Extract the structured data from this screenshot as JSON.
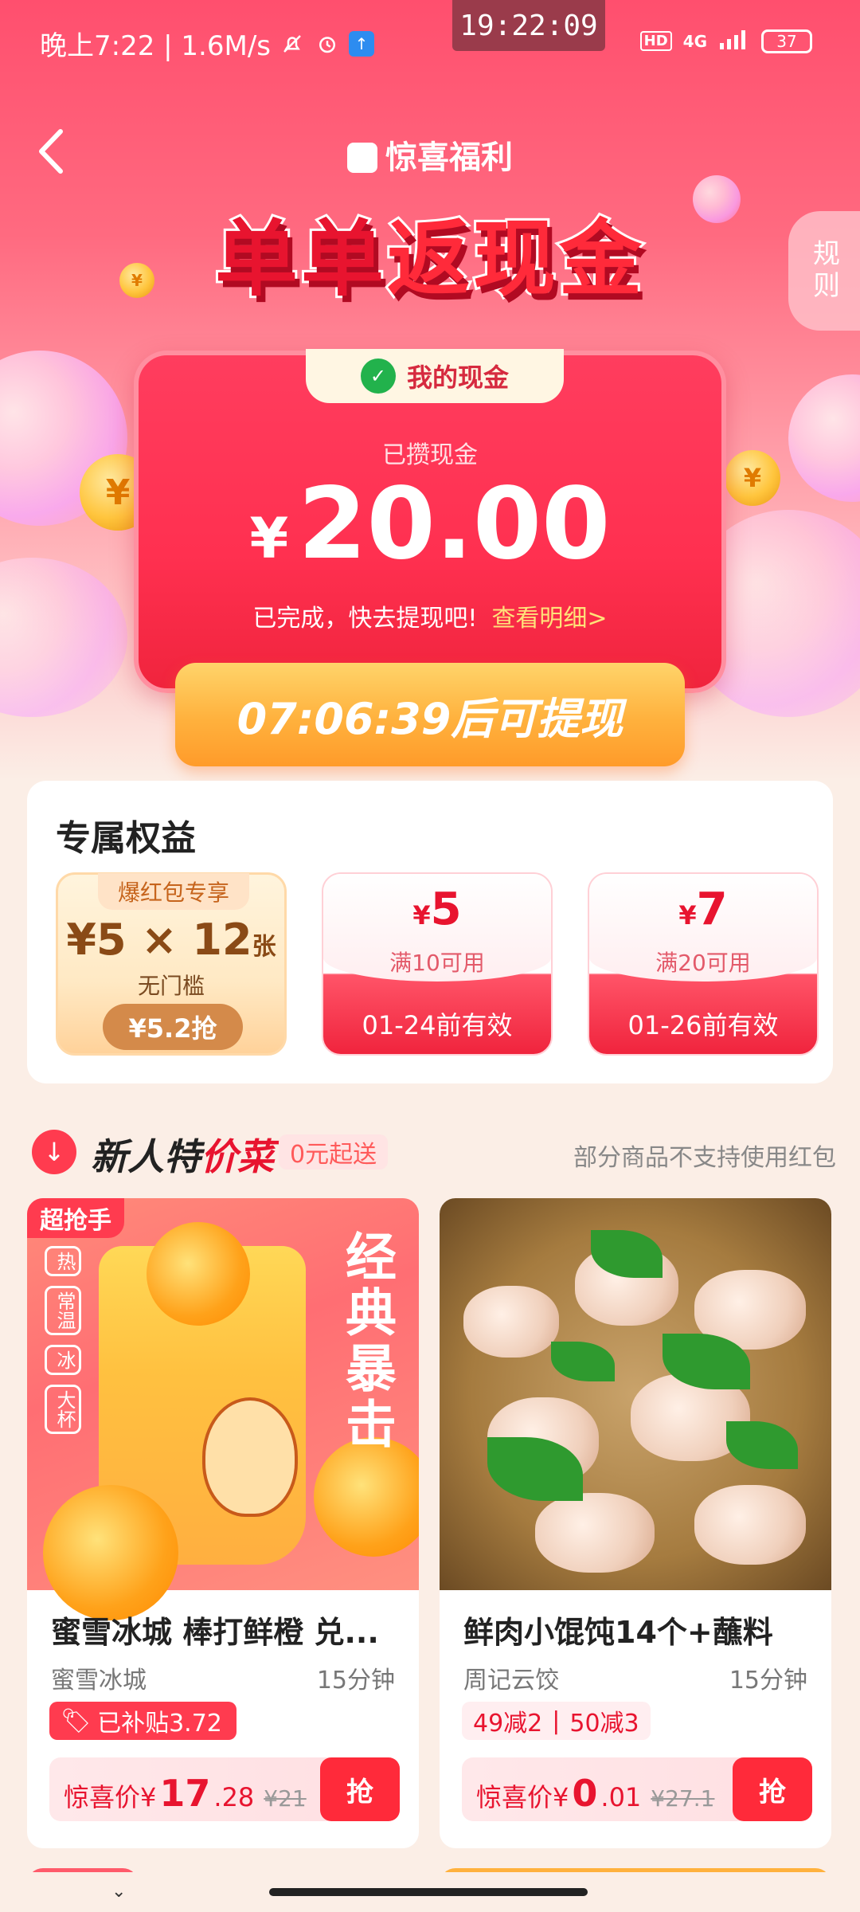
{
  "status_bar": {
    "left_text": "晚上7:22 | 1.6M/s",
    "center_time": "19:22:09",
    "hd": "HD",
    "network": "4G",
    "battery": "37"
  },
  "header": {
    "brand": "惊喜福利",
    "title_a": "单单",
    "title_b": "返现金",
    "rules": "规则"
  },
  "cash_card": {
    "tab_label": "我的现金",
    "saved_label": "已攒现金",
    "currency": "¥",
    "amount": "20.00",
    "done_text": "已完成，快去提现吧!",
    "detail_link": "查看明细>",
    "withdraw": "07:06:39后可提现"
  },
  "benefits": {
    "title": "专属权益",
    "bonus": {
      "tag": "爆红包专享",
      "value": "¥5 × 12",
      "unit": "张",
      "sub": "无门槛",
      "button": "¥5.2抢"
    },
    "coupons": [
      {
        "currency": "¥",
        "value": "5",
        "condition": "满10可用",
        "expiry": "01-24前有效"
      },
      {
        "currency": "¥",
        "value": "7",
        "condition": "满20可用",
        "expiry": "01-26前有效"
      }
    ]
  },
  "section": {
    "title_a": "新人特",
    "title_b": "价菜",
    "pill": "0元起送",
    "note": "部分商品不支持使用红包"
  },
  "products": [
    {
      "badge": "超抢手",
      "options": [
        "热",
        "常温",
        "冰",
        "大杯"
      ],
      "image_text": "经典暴击",
      "name": "蜜雪冰城 棒打鲜橙 兑...",
      "shop": "蜜雪冰城",
      "time": "15分钟",
      "subsidy": "已补贴3.72",
      "price_label": "惊喜价¥",
      "price_int": "17",
      "price_dec": ".28",
      "old_price": "¥21",
      "grab": "抢"
    },
    {
      "name": "鲜肉小馄饨14个+蘸料",
      "shop": "周记云饺",
      "time": "15分钟",
      "discounts": [
        "49减2",
        "|",
        "50减3"
      ],
      "price_label": "惊喜价¥",
      "price_int": "0",
      "price_dec": ".01",
      "old_price": "¥27.1",
      "grab": "抢"
    }
  ]
}
